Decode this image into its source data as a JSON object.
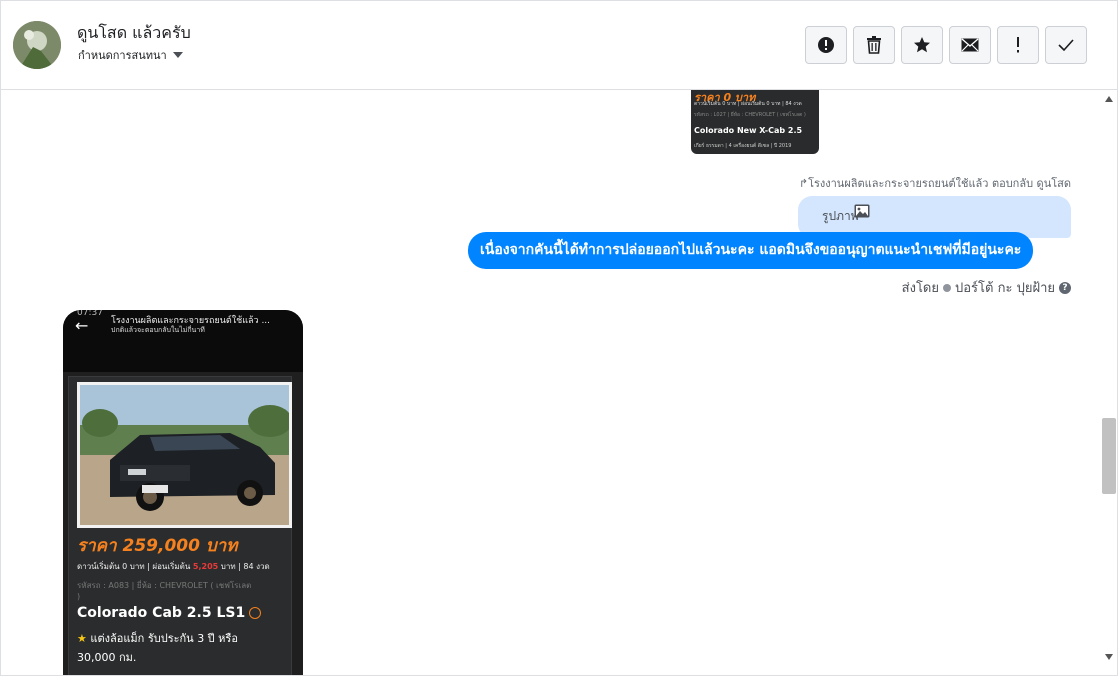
{
  "header": {
    "name": "ดูนโสด แล้วครับ",
    "subtitle": "กำหนดการสนทนา",
    "actions": [
      {
        "icon": "alert-circle-icon"
      },
      {
        "icon": "trash-icon"
      },
      {
        "icon": "star-icon"
      },
      {
        "icon": "envelope-icon"
      },
      {
        "icon": "exclamation-icon"
      },
      {
        "icon": "check-icon"
      }
    ]
  },
  "thread": {
    "top_card": {
      "price": "ราคา 0 บาท",
      "line1": "ดาวน์เริ่มต้น 0 บาท | ผ่อนเริ่มต้น 0 บาท | 84 งวด",
      "line2": "รหัสรถ : L027 | ยี่ห้อ : CHEVROLET ( เชฟโรเลต )",
      "model": "Colorado New X-Cab 2.5",
      "line3": "เกียร์ ธรรมดา | 4 เครื่องยนต์ ดีเซล | ปี 2019"
    },
    "reply_note": "โรงงานผลิตและกระจายรถยนต์ใช้แล้ว ตอบกลับ ดูนโสด",
    "image_label": "รูปภาพ",
    "message": "เนื่องจากคันนี้ได้ทำการปล่อยออกไปแล้วนะคะ แอดมินจึงขออนุญาตแนะนำเชฟที่มีอยู่นะคะ",
    "sent_by_prefix": "ส่งโดย",
    "sent_by_name": "ปอร์โต้ กะ ปุยฝ้าย",
    "phone": {
      "status_time": "07:37",
      "title": "โรงงานผลิตและกระจายรถยนต์ใช้แล้ว ...",
      "subtitle": "ปกติแล้วจะตอบกลับในไม่กี่นาที",
      "price": "ราคา 259,000 บาท",
      "down_label": "ดาวน์เริ่มต้น 0 บาท | ผ่อนเริ่มต้น",
      "installment": "5,205",
      "down_suffix": "บาท | 84 งวด",
      "meta": "รหัสรถ : A083 | ยี่ห้อ : CHEVROLET ( เชฟโรเลต",
      "meta_close": ")",
      "model": "Colorado Cab 2.5 LS1",
      "feature_star": "★",
      "feature": "แต่งล้อแม็ก รับประกัน 3 ปี หรือ 30,000 กม."
    }
  },
  "colors": {
    "accent_blue": "#0084ff",
    "light_bubble": "#d4e6fd",
    "price_orange": "#f5811f",
    "installment_red": "#e83a3a"
  }
}
